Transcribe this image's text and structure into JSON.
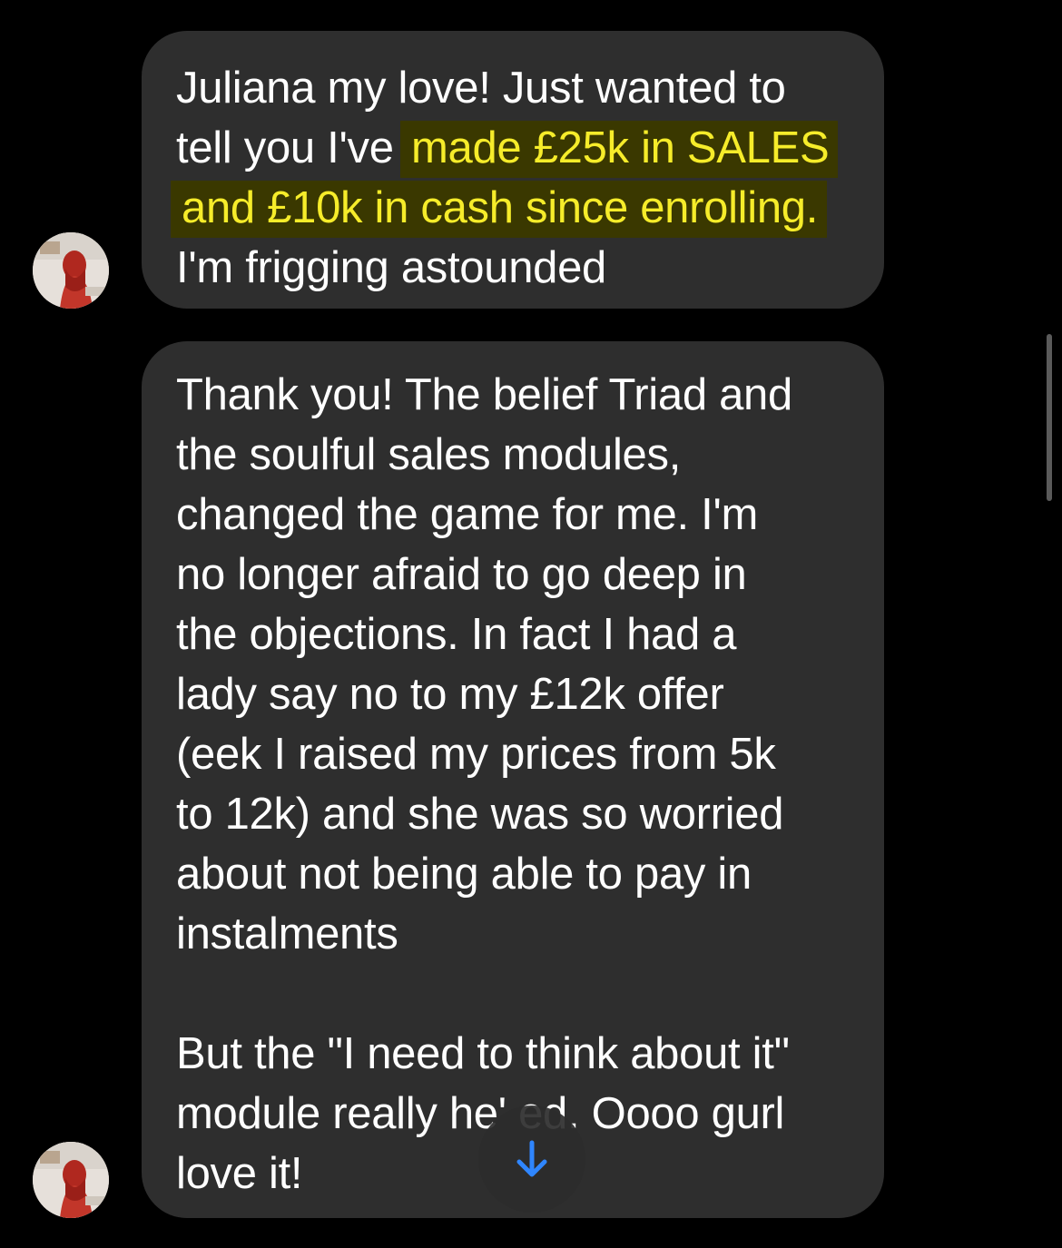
{
  "messages": [
    {
      "lines": [
        {
          "plain": "Juliana my love! Just wanted to"
        },
        {
          "plain": "tell you I've ",
          "highlight": "made £25k in SALES"
        },
        {
          "highlight": "and £10k in cash since enrolling."
        },
        {
          "plain": "I'm frigging astounded"
        }
      ]
    },
    {
      "lines": [
        "Thank you! The belief Triad and",
        "the soulful sales modules,",
        "changed the game for me. I'm",
        "no longer afraid to go deep in",
        "the objections. In fact I had a",
        "lady say no to my £12k offer",
        "(eek I raised my prices from 5k",
        "to 12k) and she was so worried",
        "about not being able to pay in",
        "instalments",
        "",
        "But the \"I need to think about it\"",
        "module really he' ed. Oooo gurl",
        "love it!"
      ]
    }
  ],
  "colors": {
    "background": "#000000",
    "bubble": "#2e2e2e",
    "highlight_text": "#f6ec2a",
    "highlight_bg": "#3a3800",
    "accent": "#2f86ff"
  },
  "icons": {
    "scroll_down": "arrow-down-icon",
    "avatar": "avatar"
  }
}
